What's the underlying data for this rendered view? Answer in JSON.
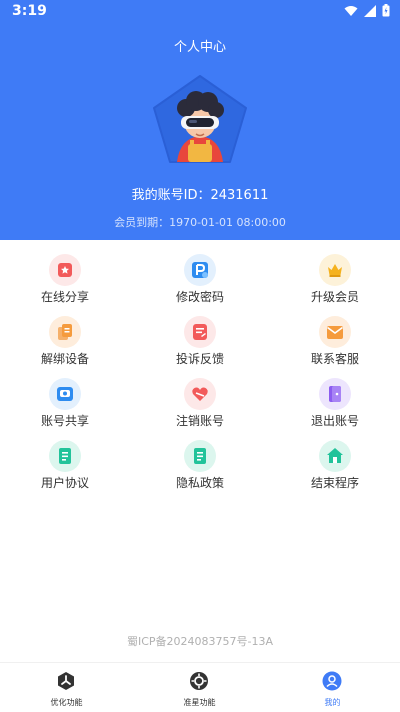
{
  "status_bar": {
    "time": "3:19"
  },
  "header": {
    "title": "个人中心",
    "account_label": "我的账号ID：",
    "account_id": "2431611",
    "expire_label": "会员到期：",
    "expire_value": "1970-01-01 08:00:00",
    "accent_color": "#3f7bf6"
  },
  "menu": [
    {
      "label": "在线分享",
      "icon": "share-icon",
      "color": "#f25a5a"
    },
    {
      "label": "修改密码",
      "icon": "password-icon",
      "color": "#2e8cf0"
    },
    {
      "label": "升级会员",
      "icon": "crown-icon",
      "color": "#f5b21e"
    },
    {
      "label": "解绑设备",
      "icon": "unbind-icon",
      "color": "#f59b3d"
    },
    {
      "label": "投诉反馈",
      "icon": "feedback-icon",
      "color": "#f25a5a"
    },
    {
      "label": "联系客服",
      "icon": "mail-icon",
      "color": "#f59b3d"
    },
    {
      "label": "账号共享",
      "icon": "account-share-icon",
      "color": "#2e8cf0"
    },
    {
      "label": "注销账号",
      "icon": "cancel-account-icon",
      "color": "#f25a5a"
    },
    {
      "label": "退出账号",
      "icon": "logout-icon",
      "color": "#8c5cf0"
    },
    {
      "label": "用户协议",
      "icon": "agreement-icon",
      "color": "#22c39a"
    },
    {
      "label": "隐私政策",
      "icon": "privacy-icon",
      "color": "#22c39a"
    },
    {
      "label": "结束程序",
      "icon": "home-exit-icon",
      "color": "#22c39a"
    }
  ],
  "footer": {
    "icp": "蜀ICP备2024083757号-13A"
  },
  "bottom_nav": [
    {
      "label": "优化功能",
      "icon": "optimize-icon",
      "active": false
    },
    {
      "label": "准星功能",
      "icon": "crosshair-icon",
      "active": false
    },
    {
      "label": "我的",
      "icon": "profile-icon",
      "active": true
    }
  ]
}
